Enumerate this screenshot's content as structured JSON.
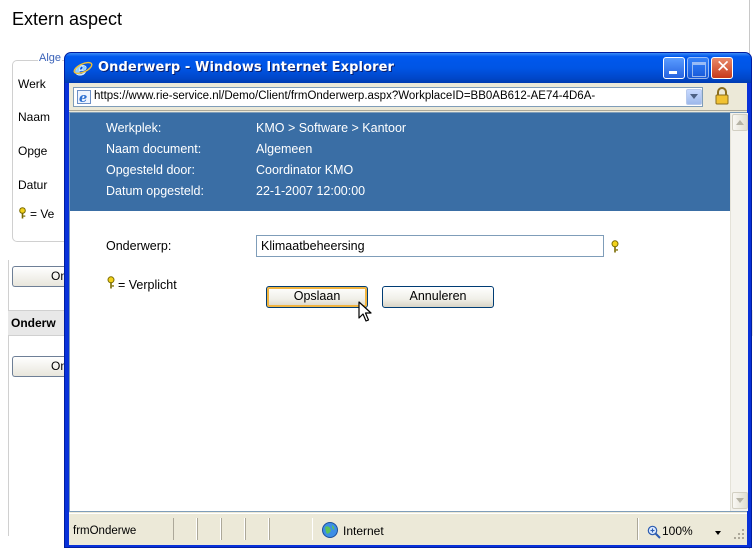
{
  "background": {
    "title": "Extern aspect",
    "legend": "Alge",
    "labels": [
      "Werk",
      "Naam",
      "Opge",
      "Datur",
      "= Ve"
    ],
    "button1": "On",
    "section": "Onderw",
    "button2": "On"
  },
  "window": {
    "title": "Onderwerp - Windows Internet Explorer",
    "close_glyph": "✕"
  },
  "address": {
    "url": "https://www.rie-service.nl/Demo/Client/frmOnderwerp.aspx?WorkplaceID=BB0AB612-AE74-4D6A-"
  },
  "info": [
    {
      "label": "Werkplek:",
      "value": "KMO > Software > Kantoor"
    },
    {
      "label": "Naam document:",
      "value": "Algemeen"
    },
    {
      "label": "Opgesteld door:",
      "value": "Coordinator KMO"
    },
    {
      "label": "Datum opgesteld:",
      "value": "22-1-2007 12:00:00"
    }
  ],
  "form": {
    "subject_label": "Onderwerp:",
    "subject_value": "Klimaatbeheersing",
    "required_note": "= Verplicht",
    "save_label": "Opslaan",
    "cancel_label": "Annuleren"
  },
  "status": {
    "text": "frmOnderwe",
    "zone": "Internet",
    "zoom": "100%"
  },
  "colors": {
    "info_band": "#3a6ea5",
    "title_bar": "#0055e5",
    "legend": "#3a62b8"
  }
}
